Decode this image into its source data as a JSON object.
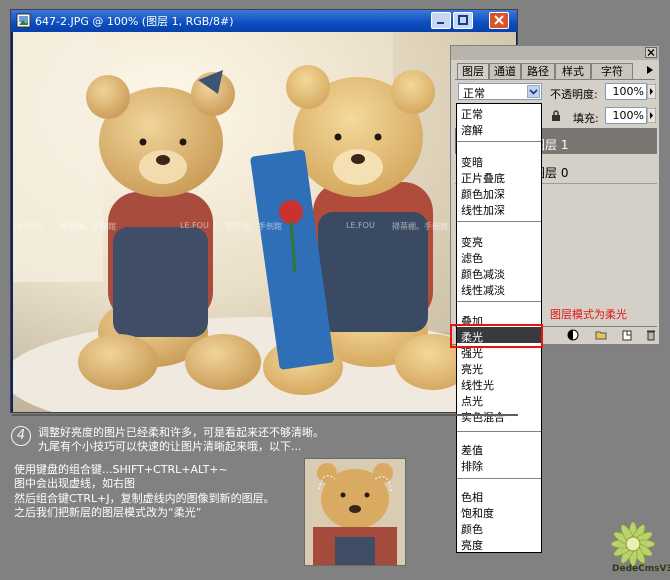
{
  "document": {
    "title": "647-2.JPG @ 100% (图层 1, RGB/8#)"
  },
  "layers_panel": {
    "tabs": [
      "图层",
      "通道",
      "路径",
      "样式",
      "字符"
    ],
    "blend_mode": "正常",
    "opacity_label": "不透明度:",
    "opacity_value": "100%",
    "fill_label": "填充:",
    "fill_value": "100%",
    "layers": [
      {
        "name": "图层 1",
        "selected": true
      },
      {
        "name": "图层 0",
        "selected": false
      }
    ],
    "annotation": "图层模式为柔光"
  },
  "blend_modes": {
    "group1": [
      "正常",
      "溶解"
    ],
    "group2": [
      "变暗",
      "正片叠底",
      "颜色加深",
      "线性加深"
    ],
    "group3": [
      "变亮",
      "滤色",
      "颜色减淡",
      "线性减淡"
    ],
    "group4": [
      "叠加",
      "柔光",
      "强光",
      "亮光",
      "线性光",
      "点光",
      "实色混合"
    ],
    "group5": [
      "差值",
      "排除"
    ],
    "group6": [
      "色相",
      "饱和度",
      "颜色",
      "亮度"
    ],
    "selected": "柔光"
  },
  "tutorial": {
    "step_number": "4",
    "para1_line1": "调整好亮度的图片已经柔和许多，可是看起来还不够清晰。",
    "para1_line2": "九尾有个小技巧可以快速的让图片清晰起来哦，以下...",
    "para2_line1": "使用键盘的组合键...SHIFT+CTRL+ALT+~",
    "para2_line2": "图中会出现虚线，如右图",
    "para2_line3": "然后组合键CTRL+J，复制虚线内的图像到新的图层。",
    "para2_line4": "之后我们把新层的图层模式改为“柔光”"
  },
  "watermark": {
    "brand": "LE.FOU",
    "text": "掃蒂棚。手劍館"
  },
  "logo": {
    "text": "DedeCmsV3"
  }
}
